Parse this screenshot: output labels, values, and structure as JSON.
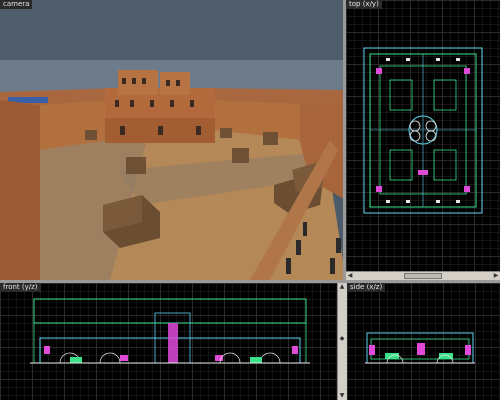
{
  "viewports": {
    "camera": {
      "label": "camera"
    },
    "top": {
      "label": "top (x/y)"
    },
    "front": {
      "label": "front (y/z)"
    },
    "side": {
      "label": "side (x/z)"
    }
  },
  "icons": {
    "scroll_left": "triangle-left",
    "scroll_right": "triangle-right",
    "scroll_up": "triangle-up",
    "scroll_down": "triangle-down"
  },
  "colors": {
    "sky": "#4c5a6a",
    "sand": "#b88a5a",
    "wall": "#b06a3e",
    "grid_background": "#000000",
    "wireframe_green": "#39e28a",
    "wireframe_cyan": "#5fd3f0",
    "wireframe_magenta": "#e04ad8",
    "wireframe_white": "#e8e8e8"
  }
}
